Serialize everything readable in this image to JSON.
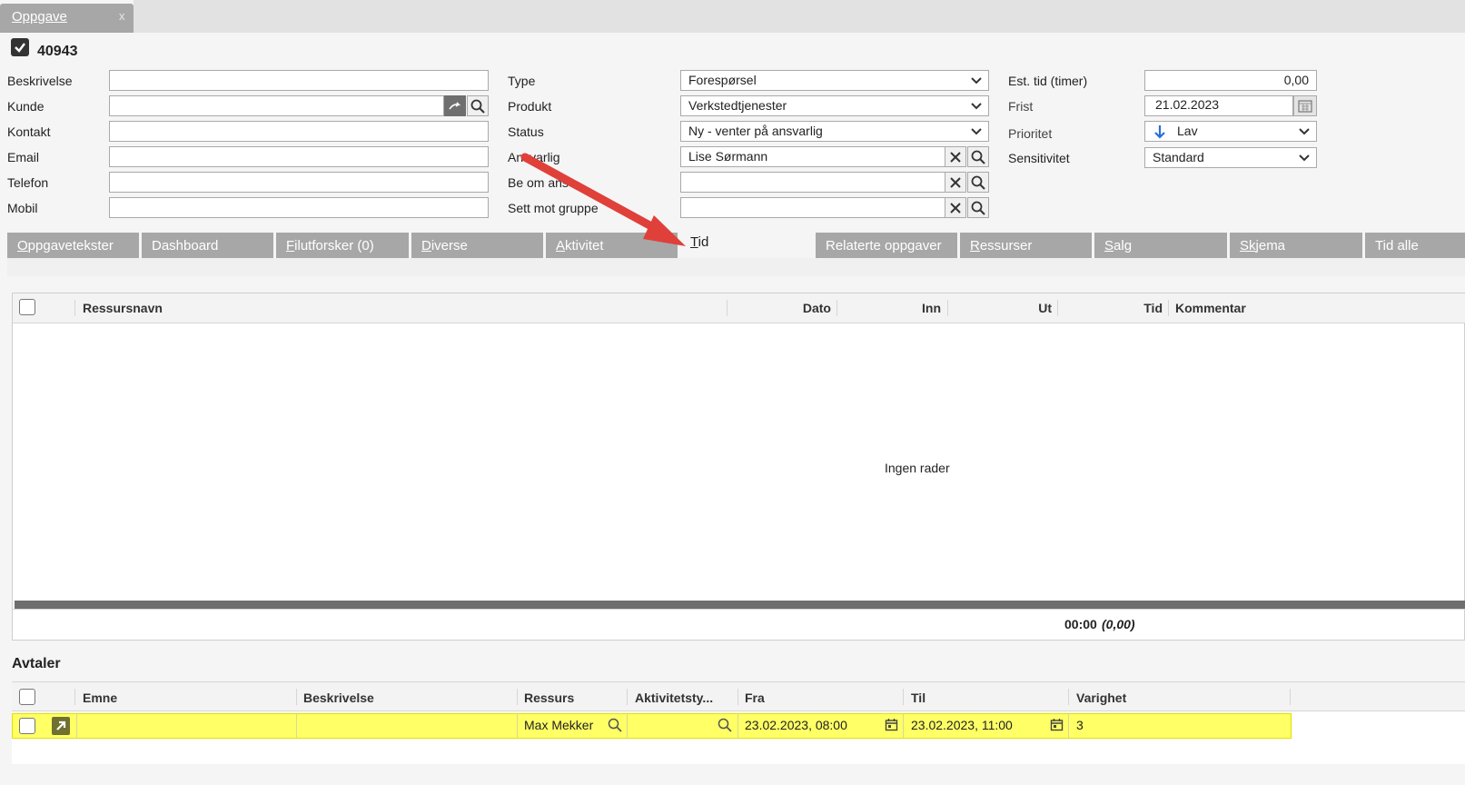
{
  "window_tab": {
    "label": "Oppgave",
    "close": "x"
  },
  "record": {
    "number": "40943"
  },
  "form_left": [
    {
      "label": "Beskrivelse",
      "value": ""
    },
    {
      "label": "Kunde",
      "value": ""
    },
    {
      "label": "Kontakt",
      "value": ""
    },
    {
      "label": "Email",
      "value": ""
    },
    {
      "label": "Telefon",
      "value": ""
    },
    {
      "label": "Mobil",
      "value": ""
    }
  ],
  "form_mid": [
    {
      "label": "Type",
      "value": "Forespørsel"
    },
    {
      "label": "Produkt",
      "value": "Verkstedtjenester"
    },
    {
      "label": "Status",
      "value": "Ny - venter på ansvarlig"
    },
    {
      "label": "Ansvarlig",
      "value": "Lise Sørmann"
    },
    {
      "label": "Be om ans",
      "value": ""
    },
    {
      "label": "Sett mot gruppe",
      "value": ""
    }
  ],
  "form_right": {
    "est_label": "Est. tid (timer)",
    "est_value": "0,00",
    "frist_label": "Frist",
    "frist_value": "21.02.2023",
    "prioritet_label": "Prioritet",
    "prioritet_value": "Lav",
    "sensitivitet_label": "Sensitivitet",
    "sensitivitet_value": "Standard"
  },
  "tabs": [
    {
      "first": "O",
      "rest": "ppgavetekster"
    },
    {
      "first": "",
      "rest": "Dashboard"
    },
    {
      "first": "F",
      "rest": "ilutforsker (0)"
    },
    {
      "first": "D",
      "rest": "iverse"
    },
    {
      "first": "A",
      "rest": "ktivitet"
    },
    {
      "first": "T",
      "rest": "id"
    },
    {
      "first": "",
      "rest": "Relaterte oppgaver"
    },
    {
      "first": "R",
      "rest": "essurser"
    },
    {
      "first": "S",
      "rest": "alg"
    },
    {
      "first": "Sk",
      "rest": "jema"
    },
    {
      "first": "",
      "rest": "Tid alle"
    }
  ],
  "time_grid": {
    "columns": [
      "Ressursnavn",
      "Dato",
      "Inn",
      "Ut",
      "Tid",
      "Kommentar"
    ],
    "empty_text": "Ingen rader",
    "total": "00:00",
    "total_paren": "(0,00)"
  },
  "avtaler": {
    "title": "Avtaler",
    "columns": [
      "Emne",
      "Beskrivelse",
      "Ressurs",
      "Aktivitetsty...",
      "Fra",
      "Til",
      "Varighet"
    ],
    "row": {
      "emne": "",
      "beskrivelse": "",
      "ressurs": "Max Mekker",
      "aktivitetstype": "",
      "fra": "23.02.2023, 08:00",
      "til": "23.02.2023, 11:00",
      "varighet": "3"
    }
  },
  "colors": {
    "tab_gray": "#a7a7a7",
    "highlight": "#ffff66",
    "arrow": "#e0403a",
    "priority_arrow": "#2a6fd6"
  }
}
